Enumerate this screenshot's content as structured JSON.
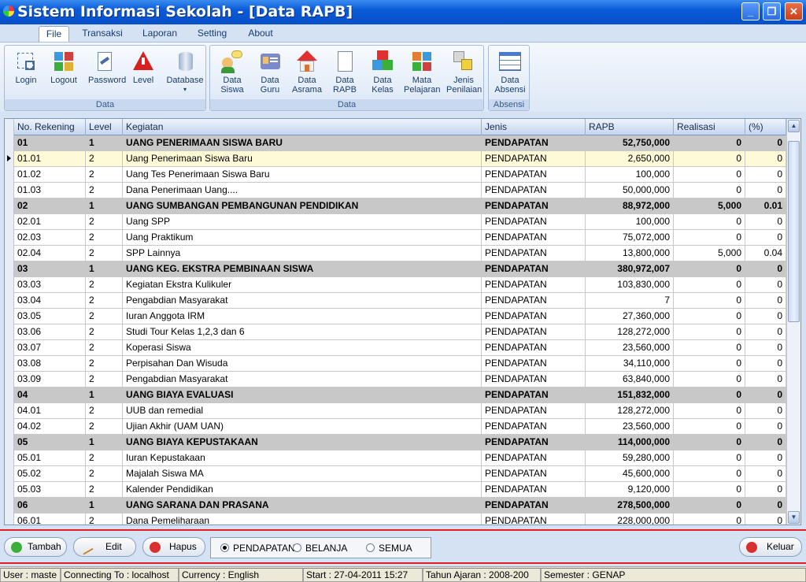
{
  "window": {
    "title": "Sistem Informasi Sekolah - [Data RAPB]"
  },
  "menu": {
    "tabs": [
      {
        "label": "File",
        "active": true
      },
      {
        "label": "Transaksi"
      },
      {
        "label": "Laporan"
      },
      {
        "label": "Setting"
      },
      {
        "label": "About"
      }
    ]
  },
  "ribbon": {
    "groups": [
      {
        "label": "Data",
        "buttons": [
          {
            "label": "Login",
            "icon": "login-icon"
          },
          {
            "label": "Logout",
            "icon": "logout-icon"
          },
          {
            "label": "Password",
            "icon": "password-icon"
          },
          {
            "label": "Level",
            "icon": "warning-icon"
          },
          {
            "label": "Database",
            "icon": "database-icon",
            "dropdown": "▾"
          }
        ]
      },
      {
        "label": "Data",
        "buttons": [
          {
            "label": "Data Siswa",
            "icon": "students-icon"
          },
          {
            "label": "Data Guru",
            "icon": "teacher-card-icon"
          },
          {
            "label": "Data Asrama",
            "icon": "house-icon"
          },
          {
            "label": "Data RAPB",
            "icon": "document-icon"
          },
          {
            "label": "Data Kelas",
            "icon": "cubes-icon"
          },
          {
            "label": "Mata Pelajaran",
            "icon": "subjects-icon"
          },
          {
            "label": "Jenis Penilaian",
            "icon": "grading-icon"
          }
        ]
      },
      {
        "label": "Absensi",
        "buttons": [
          {
            "label": "Data Absensi",
            "icon": "calendar-grid-icon"
          }
        ]
      }
    ]
  },
  "grid": {
    "columns": [
      "No. Rekening",
      "Level",
      "Kegiatan",
      "Jenis",
      "RAPB",
      "Realisasi",
      "(%)"
    ],
    "selected_row": 1,
    "rows": [
      [
        "01",
        "1",
        "UANG PENERIMAAN SISWA BARU",
        "PENDAPATAN",
        "52,750,000",
        "0",
        "0"
      ],
      [
        "01.01",
        "2",
        "Uang Penerimaan Siswa Baru",
        "PENDAPATAN",
        "2,650,000",
        "0",
        "0"
      ],
      [
        "01.02",
        "2",
        "Uang Tes Penerimaan Siswa Baru",
        "PENDAPATAN",
        "100,000",
        "0",
        "0"
      ],
      [
        "01.03",
        "2",
        "Dana Penerimaan Uang....",
        "PENDAPATAN",
        "50,000,000",
        "0",
        "0"
      ],
      [
        "02",
        "1",
        "UANG SUMBANGAN PEMBANGUNAN PENDIDIKAN",
        "PENDAPATAN",
        "88,972,000",
        "5,000",
        "0.01"
      ],
      [
        "02.01",
        "2",
        "Uang SPP",
        "PENDAPATAN",
        "100,000",
        "0",
        "0"
      ],
      [
        "02.03",
        "2",
        "Uang Praktikum",
        "PENDAPATAN",
        "75,072,000",
        "0",
        "0"
      ],
      [
        "02.04",
        "2",
        "SPP Lainnya",
        "PENDAPATAN",
        "13,800,000",
        "5,000",
        "0.04"
      ],
      [
        "03",
        "1",
        "UANG KEG. EKSTRA  PEMBINAAN SISWA",
        "PENDAPATAN",
        "380,972,007",
        "0",
        "0"
      ],
      [
        "03.03",
        "2",
        "Kegiatan Ekstra Kulikuler",
        "PENDAPATAN",
        "103,830,000",
        "0",
        "0"
      ],
      [
        "03.04",
        "2",
        "Pengabdian Masyarakat",
        "PENDAPATAN",
        "7",
        "0",
        "0"
      ],
      [
        "03.05",
        "2",
        "Iuran Anggota IRM",
        "PENDAPATAN",
        "27,360,000",
        "0",
        "0"
      ],
      [
        "03.06",
        "2",
        "Studi Tour Kelas 1,2,3 dan 6",
        "PENDAPATAN",
        "128,272,000",
        "0",
        "0"
      ],
      [
        "03.07",
        "2",
        "Koperasi Siswa",
        "PENDAPATAN",
        "23,560,000",
        "0",
        "0"
      ],
      [
        "03.08",
        "2",
        "Perpisahan Dan Wisuda",
        "PENDAPATAN",
        "34,110,000",
        "0",
        "0"
      ],
      [
        "03.09",
        "2",
        "Pengabdian Masyarakat",
        "PENDAPATAN",
        "63,840,000",
        "0",
        "0"
      ],
      [
        "04",
        "1",
        "UANG BIAYA EVALUASI",
        "PENDAPATAN",
        "151,832,000",
        "0",
        "0"
      ],
      [
        "04.01",
        "2",
        "UUB dan remedial",
        "PENDAPATAN",
        "128,272,000",
        "0",
        "0"
      ],
      [
        "04.02",
        "2",
        "Ujian Akhir (UAM  UAN)",
        "PENDAPATAN",
        "23,560,000",
        "0",
        "0"
      ],
      [
        "05",
        "1",
        "UANG BIAYA KEPUSTAKAAN",
        "PENDAPATAN",
        "114,000,000",
        "0",
        "0"
      ],
      [
        "05.01",
        "2",
        "Iuran Kepustakaan",
        "PENDAPATAN",
        "59,280,000",
        "0",
        "0"
      ],
      [
        "05.02",
        "2",
        "Majalah Siswa MA",
        "PENDAPATAN",
        "45,600,000",
        "0",
        "0"
      ],
      [
        "05.03",
        "2",
        "Kalender Pendidikan",
        "PENDAPATAN",
        "9,120,000",
        "0",
        "0"
      ],
      [
        "06",
        "1",
        "UANG SARANA DAN PRASANA",
        "PENDAPATAN",
        "278,500,000",
        "0",
        "0"
      ],
      [
        "06.01",
        "2",
        "Dana Pemeliharaan",
        "PENDAPATAN",
        "228,000,000",
        "0",
        "0"
      ]
    ]
  },
  "actions": {
    "add": "Tambah",
    "edit": "Edit",
    "delete": "Hapus",
    "exit": "Keluar"
  },
  "filter": {
    "options": [
      "PENDAPATAN",
      "BELANJA",
      "SEMUA"
    ],
    "selected": "PENDAPATAN"
  },
  "status": {
    "user": "User : maste",
    "connection": "Connecting To : localhost",
    "currency": "Currency : English",
    "start": "Start   : 27-04-2011 15:27",
    "year": "Tahun Ajaran : 2008-200",
    "semester": "Semester : GENAP"
  },
  "colors": {
    "titlebar": "#0a5bd8",
    "accent_line": "#e02020",
    "group_row": "#c8c8c8",
    "selected_row": "#fefad8"
  }
}
